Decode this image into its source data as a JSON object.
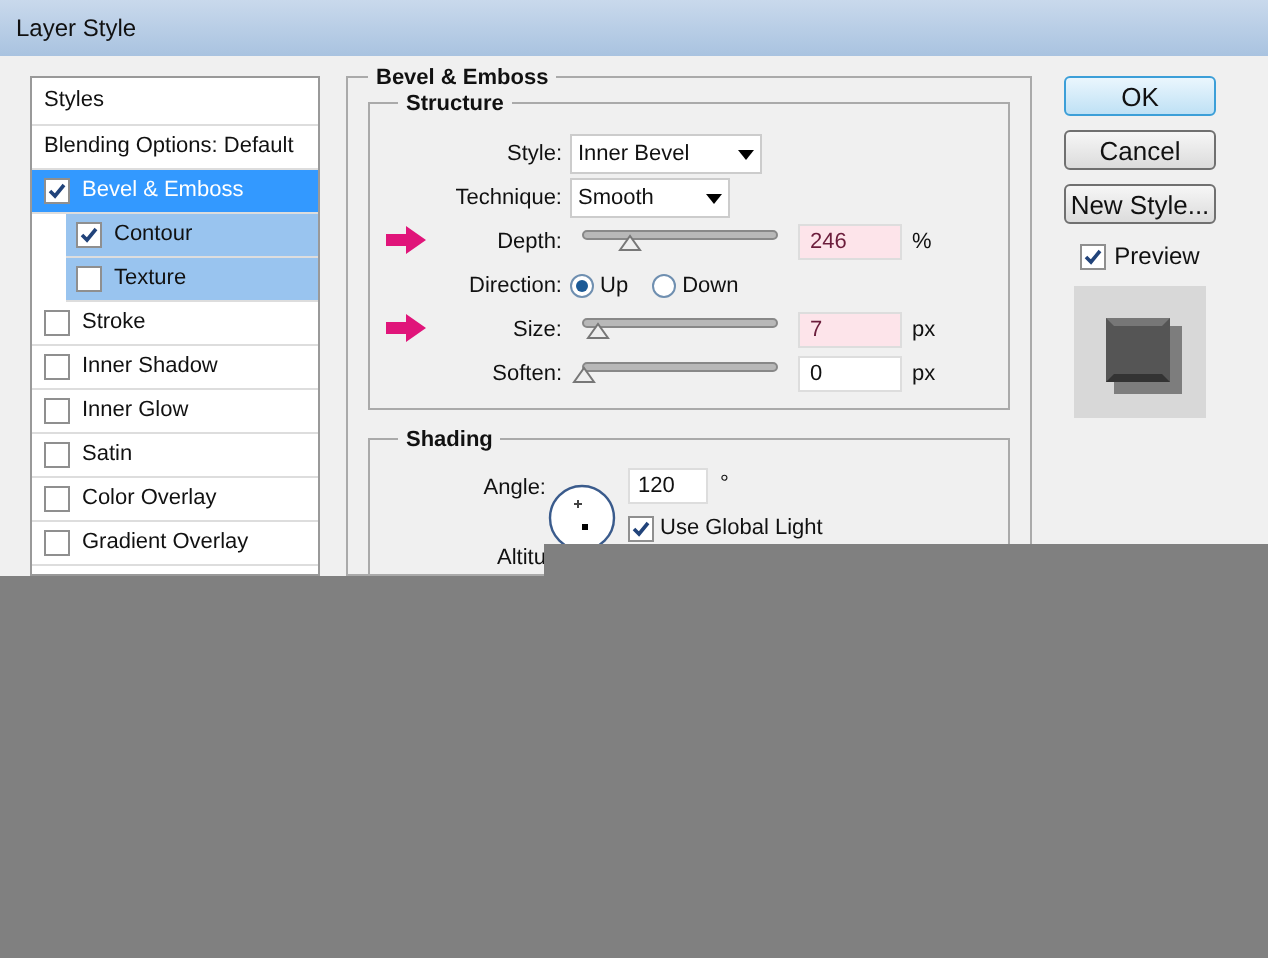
{
  "window": {
    "title": "Layer Style"
  },
  "sidebar": {
    "items": [
      {
        "kind": "header",
        "label": "Styles"
      },
      {
        "kind": "plain",
        "label": "Blending Options: Default",
        "selected": false
      },
      {
        "kind": "effect",
        "label": "Bevel & Emboss",
        "checked": true,
        "selected": true,
        "children": [
          {
            "kind": "effect",
            "label": "Contour",
            "checked": true,
            "selected": false
          },
          {
            "kind": "effect",
            "label": "Texture",
            "checked": false,
            "selected": false
          }
        ]
      },
      {
        "kind": "effect",
        "label": "Stroke",
        "checked": false,
        "selected": false
      },
      {
        "kind": "effect",
        "label": "Inner Shadow",
        "checked": false,
        "selected": false
      },
      {
        "kind": "effect",
        "label": "Inner Glow",
        "checked": false,
        "selected": false
      },
      {
        "kind": "effect",
        "label": "Satin",
        "checked": false,
        "selected": false
      },
      {
        "kind": "effect",
        "label": "Color Overlay",
        "checked": false,
        "selected": false
      },
      {
        "kind": "effect",
        "label": "Gradient Overlay",
        "checked": false,
        "selected": false
      }
    ]
  },
  "panel": {
    "title": "Bevel & Emboss",
    "structure": {
      "title": "Structure",
      "rows": [
        {
          "kind": "select",
          "label": "Style:",
          "value": "Inner Bevel"
        },
        {
          "kind": "select",
          "label": "Technique:",
          "value": "Smooth"
        },
        {
          "kind": "slider",
          "label": "Depth:",
          "level": 0.24,
          "value": "246",
          "unit": "%",
          "annotated": true
        },
        {
          "kind": "radio",
          "label": "Direction:",
          "options": [
            {
              "label": "Up",
              "selected": true
            },
            {
              "label": "Down",
              "selected": false
            }
          ]
        },
        {
          "kind": "slider",
          "label": "Size:",
          "level": 0.07,
          "value": "7",
          "unit": "px",
          "annotated": true
        },
        {
          "kind": "slider",
          "label": "Soften:",
          "level": 0,
          "value": "0",
          "unit": "px",
          "annotated": false
        }
      ]
    },
    "shading": {
      "title": "Shading",
      "angle_label": "Angle:",
      "angle_value": "120",
      "angle_unit": "°",
      "global_light": {
        "label": "Use Global Light",
        "checked": true
      },
      "altitude_label": "Altitu"
    }
  },
  "buttons": [
    {
      "label": "OK",
      "default": true
    },
    {
      "label": "Cancel",
      "default": false
    },
    {
      "label": "New Style...",
      "default": false
    }
  ],
  "preview": {
    "label": "Preview",
    "checked": true
  }
}
